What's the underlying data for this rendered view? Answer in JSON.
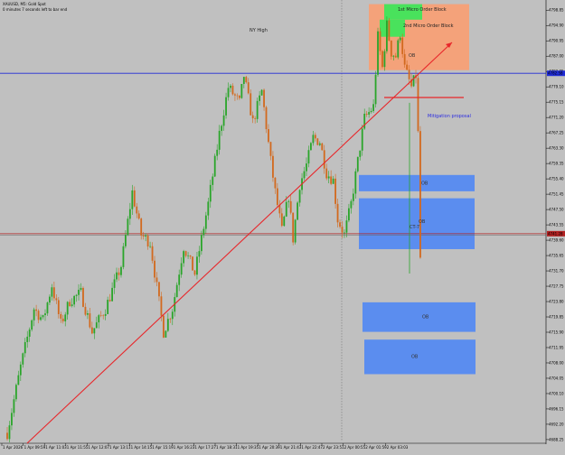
{
  "header": {
    "symbol_line": "XAUUSD, M5:  Gold Spot",
    "countdown_line": "0 minutes 7 seconds left to bar end"
  },
  "colors": {
    "background": "#c0c0c0",
    "bull_candle": "#2aa52a",
    "bear_candle": "#d2691e",
    "trendline": "#e8262a",
    "resistance_line": "#1f2bd6",
    "order_block": "#5b8def",
    "supply_zone": "#f4a27a",
    "micro_block": "#49e25c",
    "current_price": "#b22222"
  },
  "chart_data": {
    "type": "candlestick",
    "symbol": "XAUUSD",
    "timeframe": "M5",
    "ylim": [
      4688,
      4801
    ],
    "y_ticks": [
      "4798.85",
      "4794.90",
      "4790.95",
      "4787.00",
      "4783.05",
      "4779.10",
      "4775.15",
      "4771.20",
      "4767.25",
      "4763.30",
      "4759.35",
      "4755.40",
      "4751.45",
      "4747.50",
      "4743.55",
      "4739.60",
      "4735.65",
      "4731.70",
      "4727.75",
      "4723.80",
      "4719.85",
      "4715.90",
      "4711.95",
      "4708.00",
      "4704.05",
      "4700.10",
      "4696.15",
      "4692.20",
      "4688.25"
    ],
    "x_ticks": [
      "1 Apr 2026",
      "1 Apr 09:59",
      "1 Apr 11:03",
      "1 Apr 11:55",
      "1 Apr 12:07",
      "1 Apr 13:11",
      "1 Apr 14:15",
      "1 Apr 15:19",
      "1 Apr 16:23",
      "1 Apr 17:27",
      "1 Apr 18:31",
      "1 Apr 19:35",
      "1 Apr 20:39",
      "1 Apr 21:43",
      "1 Apr 22:47",
      "2 Apr 23:51",
      "2 Apr 00:55",
      "2 Apr 01:59",
      "2 Apr 03:03"
    ],
    "price_path": [
      [
        0,
        4690
      ],
      [
        6,
        4707
      ],
      [
        12,
        4722
      ],
      [
        16,
        4719
      ],
      [
        20,
        4728
      ],
      [
        24,
        4718
      ],
      [
        28,
        4724
      ],
      [
        33,
        4726
      ],
      [
        38,
        4716
      ],
      [
        44,
        4722
      ],
      [
        51,
        4733
      ],
      [
        56,
        4752
      ],
      [
        60,
        4741
      ],
      [
        64,
        4739
      ],
      [
        70,
        4716
      ],
      [
        74,
        4722
      ],
      [
        79,
        4738
      ],
      [
        84,
        4731
      ],
      [
        90,
        4749
      ],
      [
        95,
        4767
      ],
      [
        99,
        4779
      ],
      [
        104,
        4775
      ],
      [
        106,
        4782
      ],
      [
        110,
        4770
      ],
      [
        114,
        4778
      ],
      [
        118,
        4760
      ],
      [
        120,
        4752
      ],
      [
        123,
        4742
      ],
      [
        126,
        4751
      ],
      [
        128,
        4740
      ],
      [
        131,
        4754
      ],
      [
        134,
        4759
      ],
      [
        137,
        4766
      ],
      [
        140,
        4765
      ],
      [
        143,
        4757
      ],
      [
        146,
        4755
      ],
      [
        148,
        4745
      ],
      [
        151,
        4741
      ],
      [
        154,
        4749
      ],
      [
        157,
        4760
      ],
      [
        160,
        4771
      ],
      [
        164,
        4774
      ],
      [
        166,
        4792
      ],
      [
        168,
        4784
      ],
      [
        170,
        4795
      ],
      [
        172,
        4788
      ],
      [
        174,
        4787
      ],
      [
        176,
        4793
      ],
      [
        178,
        4784
      ],
      [
        181,
        4779
      ],
      [
        183,
        4782
      ],
      [
        184,
        4767
      ],
      [
        185,
        4735
      ]
    ],
    "current_price": "4741.28",
    "resistance_price": "4782.58",
    "annotations": {
      "nyhigh": "NY High",
      "micro1": "1st Micro Order Block",
      "micro2": "2nd Micro Order Block",
      "ob_top": "OB",
      "mitigation": "Mitigation proposal",
      "ob1": "OB",
      "ob2": "OB",
      "ob3": "OB",
      "ob4": "OB",
      "ct": "CT-7"
    }
  }
}
